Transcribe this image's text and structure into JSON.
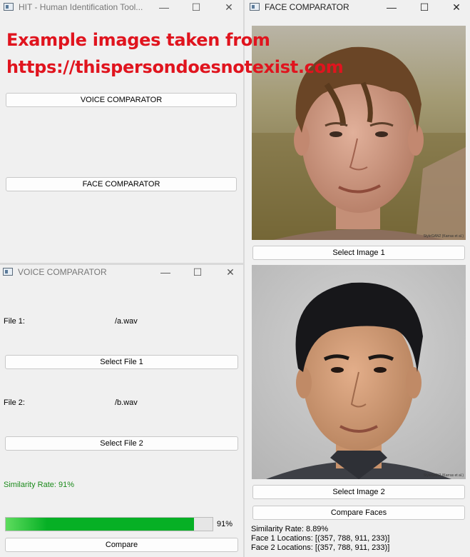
{
  "overlay": {
    "line1": "Example images taken from",
    "line2": "https://thispersondoesnotexist.com"
  },
  "main_window": {
    "title": "HIT - Human Identification Tool...",
    "voice_button": "VOICE COMPARATOR",
    "face_button": "FACE COMPARATOR",
    "controls": {
      "minimize": "—",
      "maximize": "☐",
      "close": "✕"
    }
  },
  "voice_window": {
    "title": "VOICE COMPARATOR",
    "file1_label": "File 1:",
    "file1_value": "/a.wav",
    "select_file1": "Select File 1",
    "file2_label": "File 2:",
    "file2_value": "/b.wav",
    "select_file2": "Select File 2",
    "similarity": "Similarity Rate: 91%",
    "progress": {
      "value": 91,
      "label": "91%"
    },
    "compare": "Compare",
    "controls": {
      "minimize": "—",
      "maximize": "☐",
      "close": "✕"
    }
  },
  "face_window": {
    "title": "FACE COMPARATOR",
    "select_image1": "Select Image 1",
    "select_image2": "Select Image 2",
    "compare_faces": "Compare Faces",
    "similarity": "Similarity Rate: 8.89%",
    "face1_locations": "Face 1 Locations: [(357, 788, 911, 233)]",
    "face2_locations": "Face 2 Locations: [(357, 788, 911, 233)]",
    "image_watermark": "StyleGAN2 (Karras et al.)",
    "controls": {
      "minimize": "—",
      "maximize": "☐",
      "close": "✕"
    }
  },
  "colors": {
    "overlay_text": "#e0141e",
    "progress_fill": "#06b025",
    "similarity_green": "#1b8a1b"
  }
}
